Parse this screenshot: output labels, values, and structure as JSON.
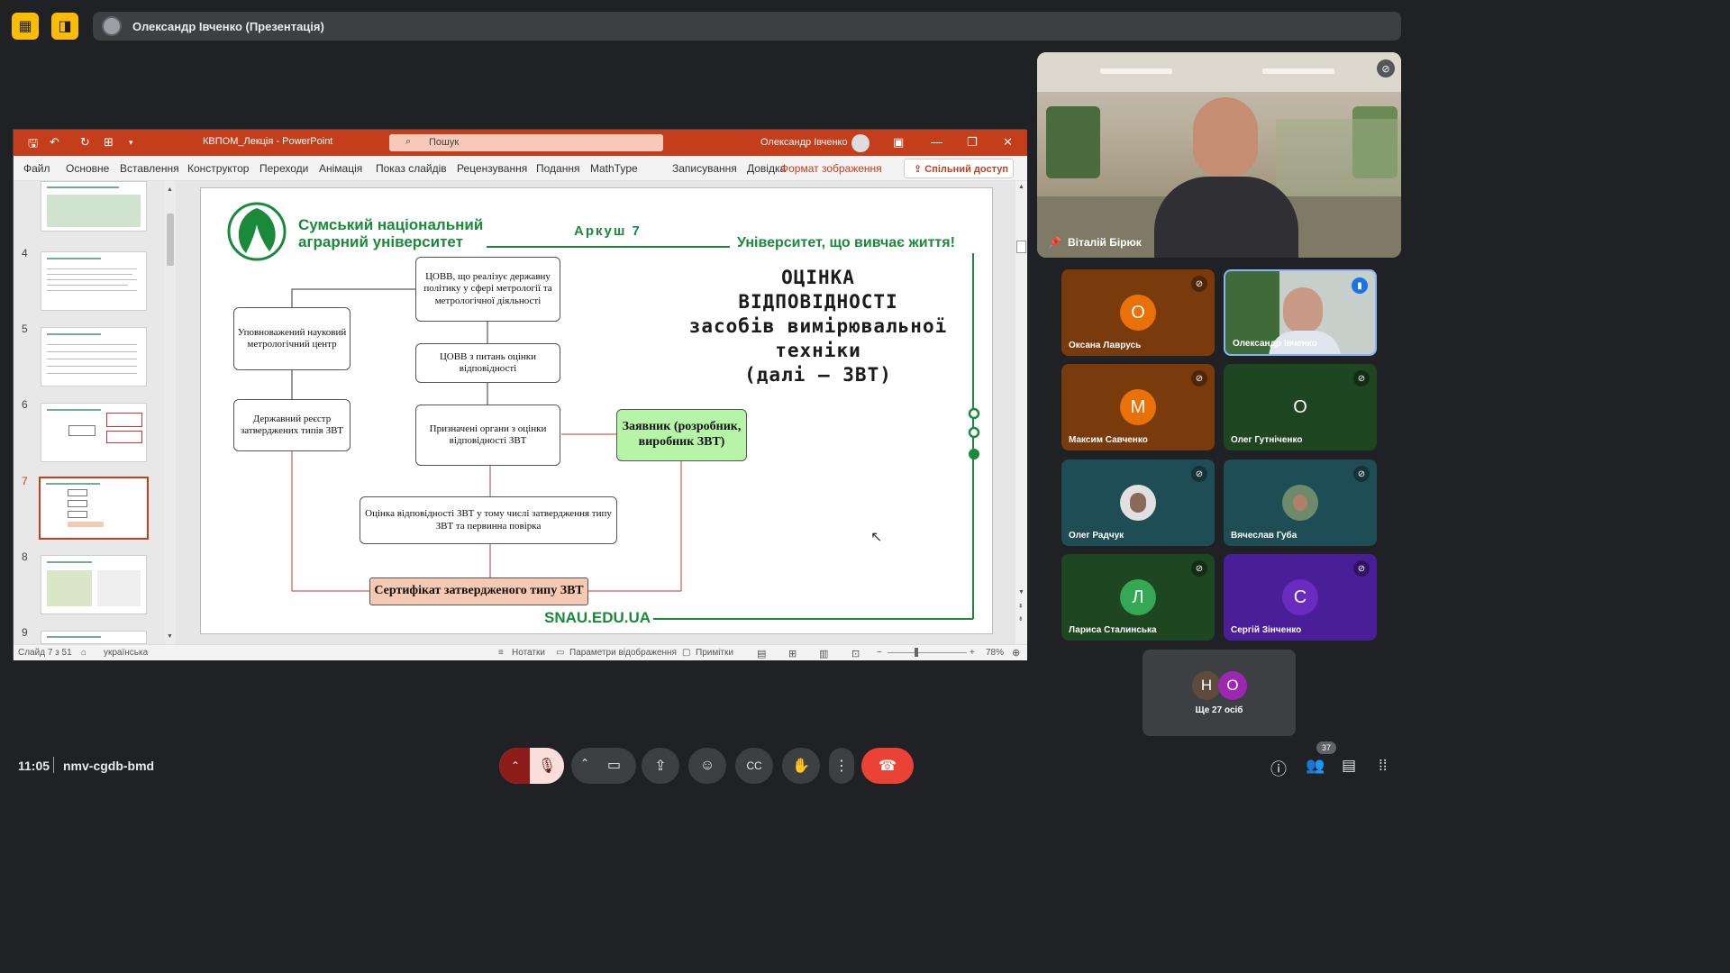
{
  "meeting": {
    "presenter_label": "Олександр Івченко (Презентація)",
    "time": "11:05",
    "code": "nmv-cgdb-bmd",
    "participants_count": "37"
  },
  "ppt": {
    "title": "КВПОМ_Лекція  -  PowerPoint",
    "search_placeholder": "Пошук",
    "user": "Олександр Івченко",
    "menu": [
      "Файл",
      "Основне",
      "Вставлення",
      "Конструктор",
      "Переходи",
      "Анімація",
      "Показ слайдів",
      "Рецензування",
      "Подання",
      "MathType",
      "Записування",
      "Довідка",
      "Формат зображення"
    ],
    "share": "Спільний доступ",
    "thumb_numbers": [
      "4",
      "5",
      "6",
      "7",
      "8",
      "9"
    ],
    "status": {
      "slide": "Слайд 7 з 51",
      "lang": "українська",
      "notes": "Нотатки",
      "display": "Параметри відображення",
      "comments": "Примітки",
      "zoom": "78%"
    }
  },
  "slide": {
    "univ_line1": "Сумський національний",
    "univ_line2": "аграрний університет",
    "sheet": "Аркуш 7",
    "motto": "Університет, що вивчає життя!",
    "heading1": "ОЦІНКА",
    "heading2": "ВІДПОВІДНОСТІ",
    "heading3": "засобів вимірювальної",
    "heading4": "техніки",
    "heading5": "(далі – ЗВТ)",
    "box_covv": "ЦОВВ, що реалізує державну політику у сфері метрології та метрологічної діяльності",
    "box_center": "Уповноважений науковий метрологічний центр",
    "box_covv2": "ЦОВВ з питань оцінки відповідності",
    "box_registry": "Державний реєстр затверджених типів ЗВТ",
    "box_bodies": "Призначені органи з оцінки відповідності ЗВТ",
    "box_applicant": "Заявник (розробник, виробник ЗВТ)",
    "box_assessment": "Оцінка відповідності ЗВТ у тому числі затвердження типу ЗВТ та первинна повірка",
    "box_certificate": "Сертифікат затвердженого типу ЗВТ",
    "footer": "SNAU.EDU.UA"
  },
  "video": {
    "main_name": "Віталій Бірюк",
    "tiles": [
      {
        "name": "Оксана Лаврусь",
        "initial": "О",
        "color": "#e8710a",
        "bg": "#7a3b0c"
      },
      {
        "name": "Олександр Івченко",
        "initial": "",
        "color": "",
        "bg": "#5b6b57"
      },
      {
        "name": "Максим Савченко",
        "initial": "М",
        "color": "#e8710a",
        "bg": "#7a3b0c"
      },
      {
        "name": "Олег Гутніченко",
        "initial": "О",
        "color": "#1e4620",
        "bg": "#1e4620"
      },
      {
        "name": "Олег Радчук",
        "initial": "",
        "color": "",
        "bg": "#1f4d55"
      },
      {
        "name": "Вячеслав Губа",
        "initial": "",
        "color": "",
        "bg": "#1f4d55"
      },
      {
        "name": "Лариса Сталинська",
        "initial": "Л",
        "color": "#34a853",
        "bg": "#1e4620"
      },
      {
        "name": "Сергій Зінченко",
        "initial": "С",
        "color": "#6a2bbf",
        "bg": "#4a1e96"
      }
    ],
    "more": "Ще 27 осіб",
    "more_initials": [
      "Н",
      "О"
    ]
  }
}
